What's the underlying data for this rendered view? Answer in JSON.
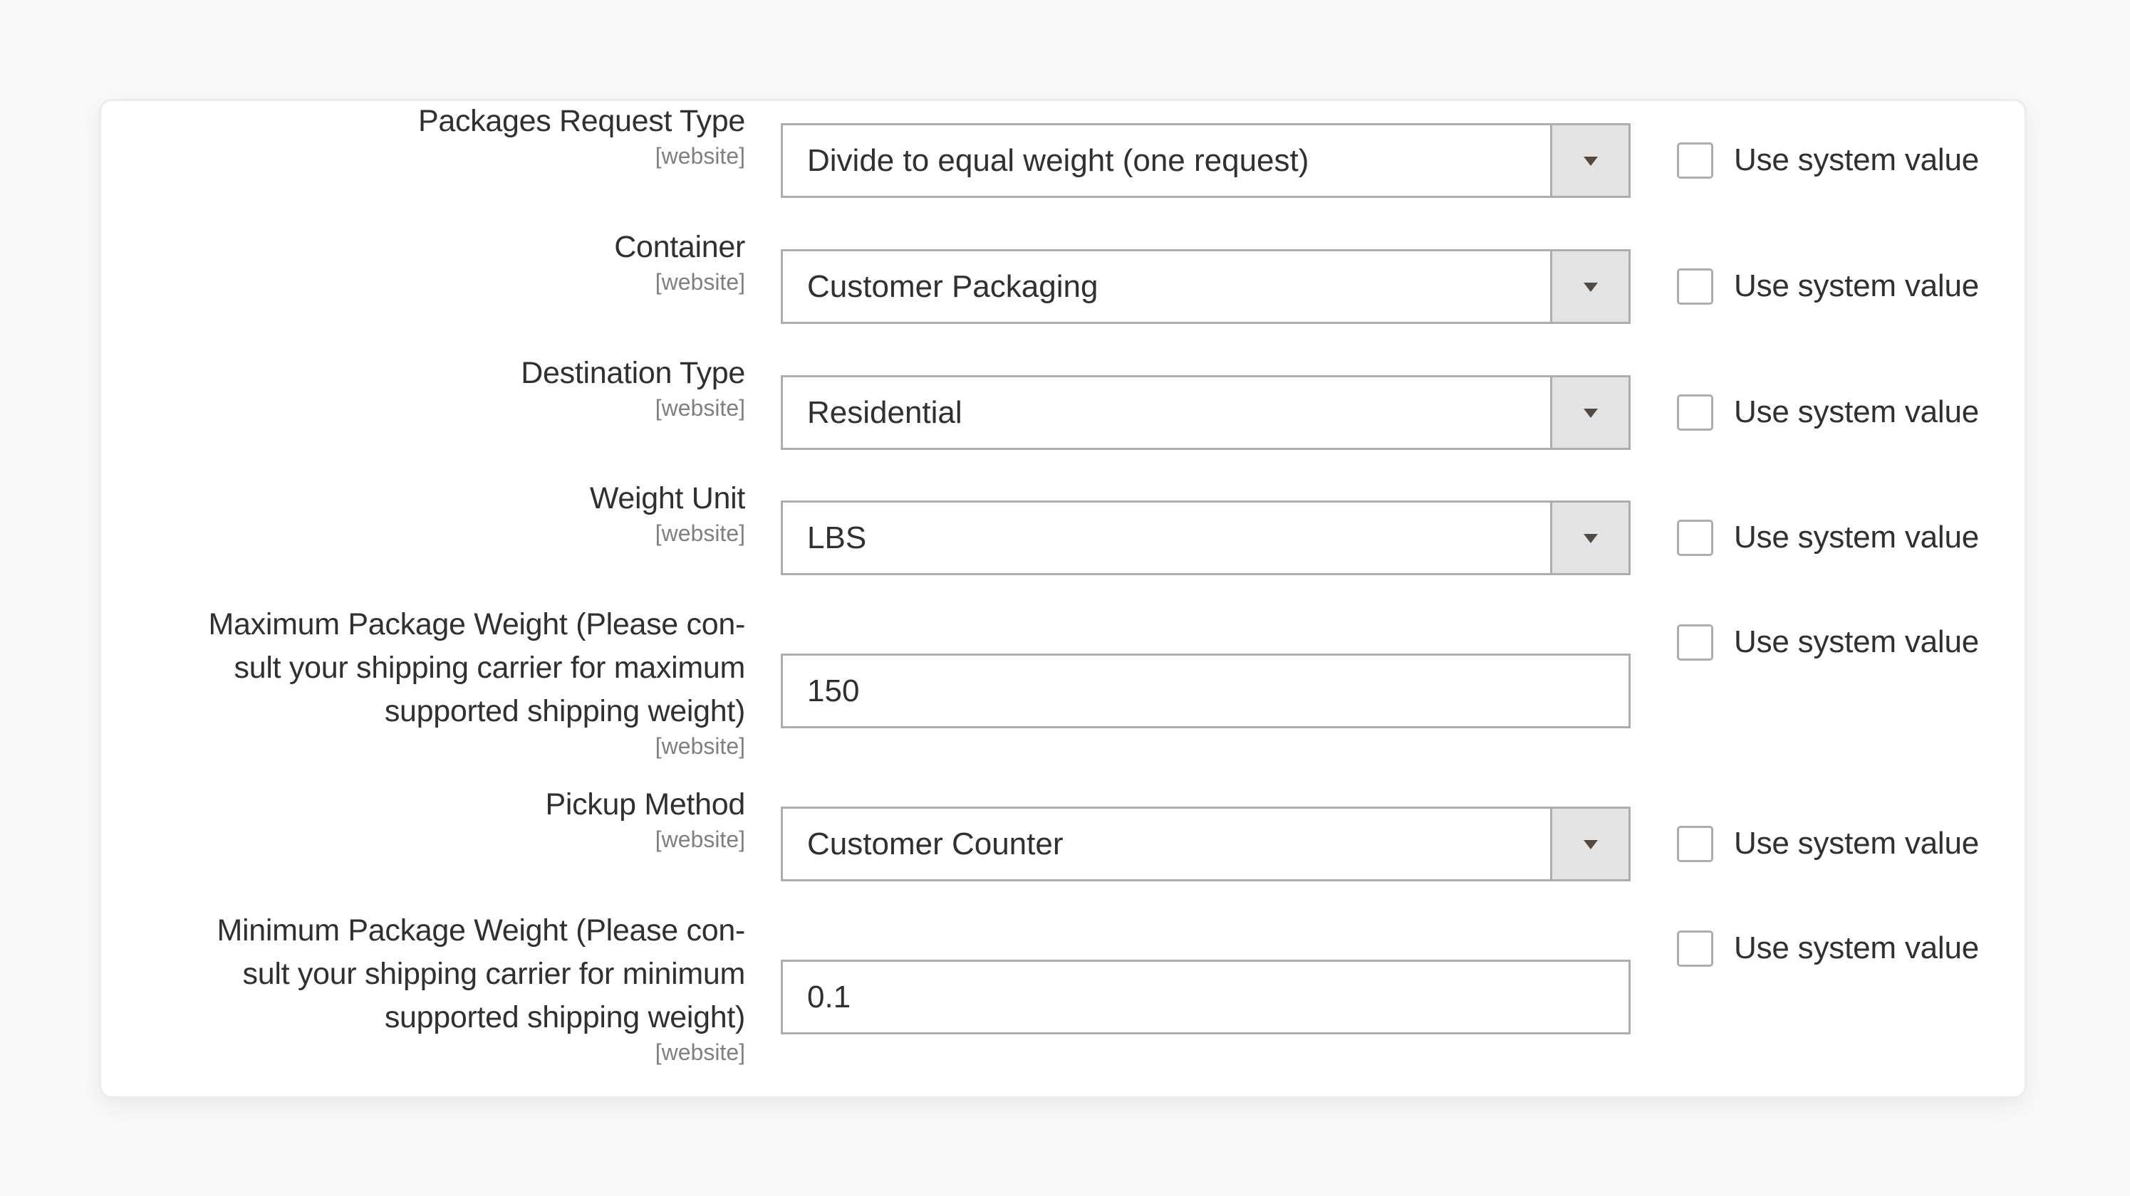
{
  "form": {
    "use_system_value_label": "Use system value",
    "rows": [
      {
        "label_lines": [
          "Packages Request Type"
        ],
        "scope": "[website]",
        "type": "select",
        "value": "Divide to equal weight (one request)",
        "use_system_value": false
      },
      {
        "label_lines": [
          "Container"
        ],
        "scope": "[website]",
        "type": "select",
        "value": "Customer Packaging",
        "use_system_value": false
      },
      {
        "label_lines": [
          "Destination Type"
        ],
        "scope": "[website]",
        "type": "select",
        "value": "Residential",
        "use_system_value": false
      },
      {
        "label_lines": [
          "Weight Unit"
        ],
        "scope": "[website]",
        "type": "select",
        "value": "LBS",
        "use_system_value": false
      },
      {
        "label_lines": [
          "Maximum Package Weight (Please con-",
          "sult your shipping carrier for maximum",
          "supported shipping weight)"
        ],
        "scope": "[website]",
        "type": "text",
        "value": "150",
        "use_system_value": false
      },
      {
        "label_lines": [
          "Pickup Method"
        ],
        "scope": "[website]",
        "type": "select",
        "value": "Customer Counter",
        "use_system_value": false
      },
      {
        "label_lines": [
          "Minimum Package Weight (Please con-",
          "sult your shipping carrier for minimum",
          "supported shipping weight)"
        ],
        "scope": "[website]",
        "type": "text",
        "value": "0.1",
        "use_system_value": false
      }
    ]
  },
  "colors": {
    "background": "#f9f9f9",
    "card": "#ffffff",
    "border": "#adadad",
    "text": "#303030",
    "scope_text": "#808080",
    "select_button": "#e3e3e3",
    "caret": "#514943"
  }
}
